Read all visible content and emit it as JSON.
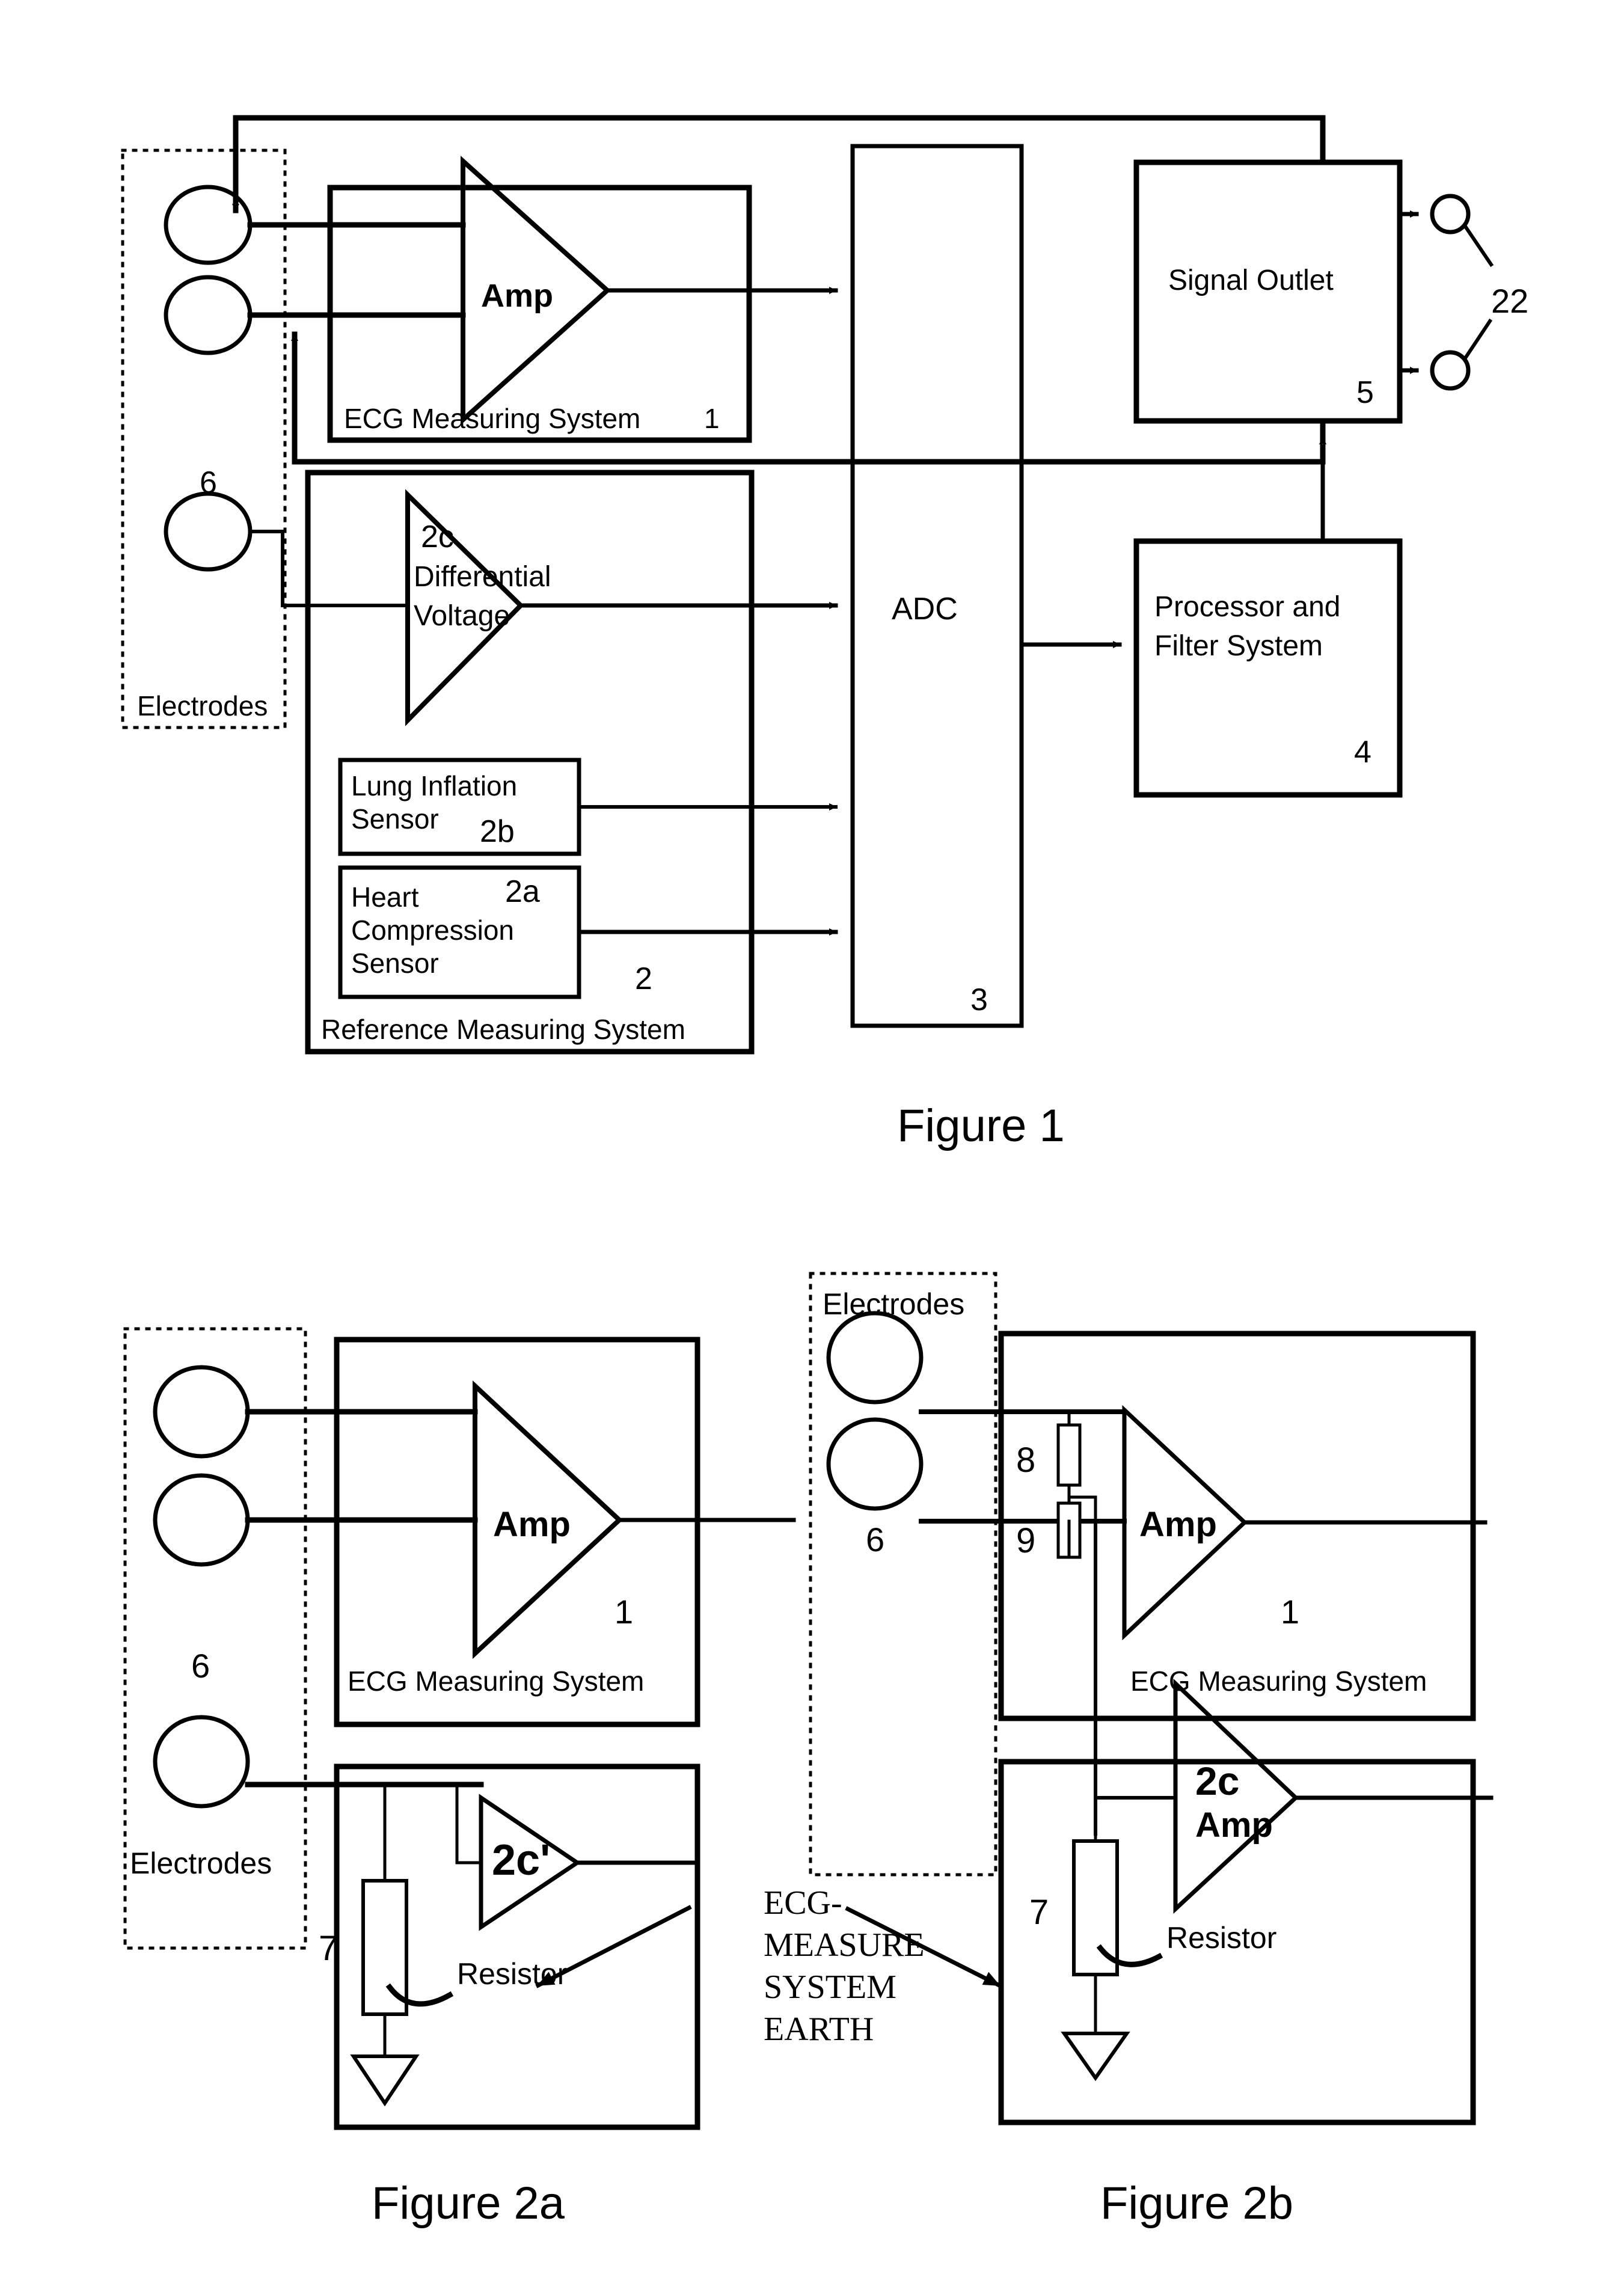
{
  "document": {
    "type": "patent-figure-sheet",
    "background_color": "#ffffff",
    "ink_color": "#000000"
  },
  "figure1": {
    "caption": "Figure 1",
    "electrodes_group": {
      "label": "Electrodes",
      "ref": "6",
      "electrode_count": 3
    },
    "ecg_measuring_system": {
      "label": "ECG Measuring System",
      "ref": "1",
      "amplifier_label": "Amp"
    },
    "reference_measuring_system": {
      "label": "Reference Measuring System",
      "ref": "2",
      "differential_voltage_amp": {
        "ref": "2c",
        "line1": "Differential",
        "line2": "Voltage"
      },
      "lung_inflation_sensor": {
        "line1": "Lung Inflation",
        "line2": "Sensor",
        "ref": "2b"
      },
      "heart_compression_sensor": {
        "line1": "Heart",
        "line2": "Compression",
        "line3": "Sensor",
        "ref": "2a"
      }
    },
    "adc": {
      "label": "ADC",
      "ref": "3"
    },
    "processor_filter_system": {
      "line1": "Processor and",
      "line2": "Filter System",
      "ref": "4"
    },
    "signal_outlet": {
      "label": "Signal Outlet",
      "ref": "5",
      "output_terminals_ref": "22",
      "output_terminal_count": 2
    }
  },
  "figure2a": {
    "caption": "Figure 2a",
    "electrodes_group": {
      "label": "Electrodes",
      "ref": "6",
      "electrode_count": 3
    },
    "ecg_measuring_system": {
      "label": "ECG Measuring System",
      "ref": "1",
      "amplifier_label": "Amp"
    },
    "reference_block": {
      "amplifier_label": "2c'",
      "resistor": {
        "label": "Resistor",
        "ref": "7"
      },
      "earth_symbol": "ground-triangle"
    }
  },
  "figure2b": {
    "caption": "Figure 2b",
    "electrodes_group": {
      "label": "Electrodes",
      "ref": "6",
      "electrode_count": 2
    },
    "ecg_measuring_system": {
      "label": "ECG Measuring System",
      "ref": "1",
      "amplifier_label": "Amp",
      "divider_resistor_top_ref": "8",
      "divider_resistor_bottom_ref": "9"
    },
    "reference_block": {
      "amplifier_ref": "2c",
      "amplifier_label": "Amp",
      "resistor": {
        "label": "Resistor",
        "ref": "7"
      },
      "earth_symbol": "ground-triangle"
    }
  },
  "annotations": {
    "earth_note": {
      "line1": "ECG-",
      "line2": "MEASURE",
      "line3": "SYSTEM",
      "line4": "EARTH"
    }
  }
}
